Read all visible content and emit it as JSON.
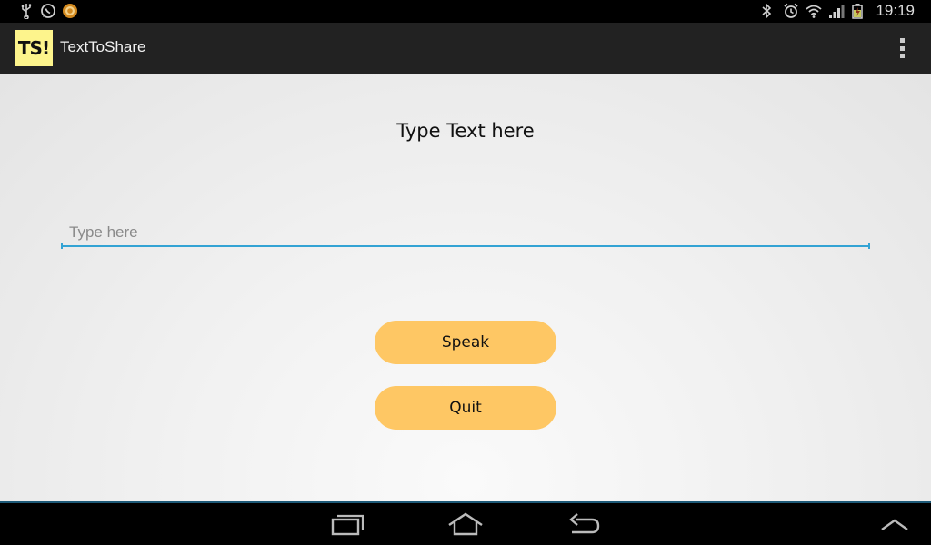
{
  "status_bar": {
    "time": "19:19",
    "left_icons": [
      "usb-icon",
      "whatsapp-icon",
      "camera-app-icon"
    ],
    "right_icons": [
      "bluetooth-icon",
      "alarm-icon",
      "wifi-icon",
      "signal-icon",
      "battery-icon"
    ]
  },
  "action_bar": {
    "logo_text": "TS!",
    "title": "TextToShare",
    "overflow_icon": "overflow-menu-icon"
  },
  "main": {
    "heading": "Type Text here",
    "input": {
      "value": "",
      "placeholder": "Type here"
    },
    "speak_label": "Speak",
    "quit_label": "Quit"
  },
  "nav_bar": {
    "icons": [
      "recent-apps-icon",
      "home-icon",
      "back-icon",
      "chevron-up-icon"
    ]
  },
  "colors": {
    "accent": "#33a3d4",
    "button": "#fec764",
    "logo_bg": "#fdf48c",
    "action_bar": "#222222"
  }
}
